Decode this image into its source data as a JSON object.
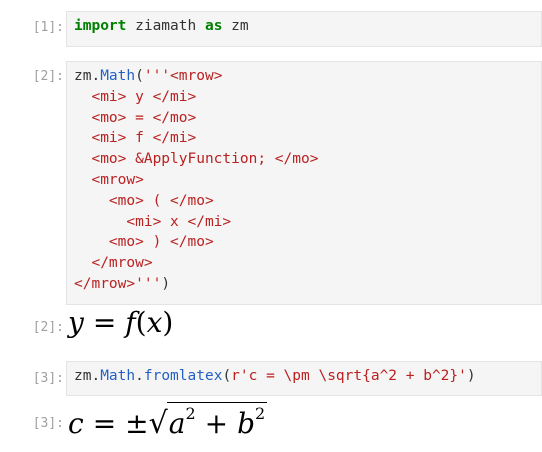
{
  "cells": [
    {
      "prompt": "[1]:",
      "kw_import": "import",
      "mod": " ziamath ",
      "kw_as": "as",
      "alias": " zm"
    },
    {
      "prompt": "[2]:",
      "obj": "zm.",
      "method": "Math",
      "open": "(",
      "lines": [
        "'''<mrow>",
        "  <mi> y </mi>",
        "  <mo> = </mo>",
        "  <mi> f </mi>",
        "  <mo> &ApplyFunction; </mo>",
        "  <mrow>",
        "    <mo> ( </mo>",
        "      <mi> x </mi>",
        "    <mo> ) </mo>",
        "  </mrow>",
        "</mrow>'''"
      ],
      "close": ")"
    },
    {
      "prompt": "[3]:",
      "obj": "zm.",
      "method1": "Math",
      "dot": ".",
      "method2": "fromlatex",
      "open": "(",
      "arg": "r'c = \\pm \\sqrt{a^2 + b^2}'",
      "close": ")"
    }
  ],
  "outputs": [
    {
      "prompt": "[2]:",
      "y": "y",
      "eq": "=",
      "f": "f",
      "lp": "(",
      "x": "x",
      "rp": ")"
    },
    {
      "prompt": "[3]:",
      "c": "c",
      "eq": "=",
      "pm": "±",
      "a": "a",
      "b": "b",
      "two": "2",
      "plus": "+"
    }
  ]
}
